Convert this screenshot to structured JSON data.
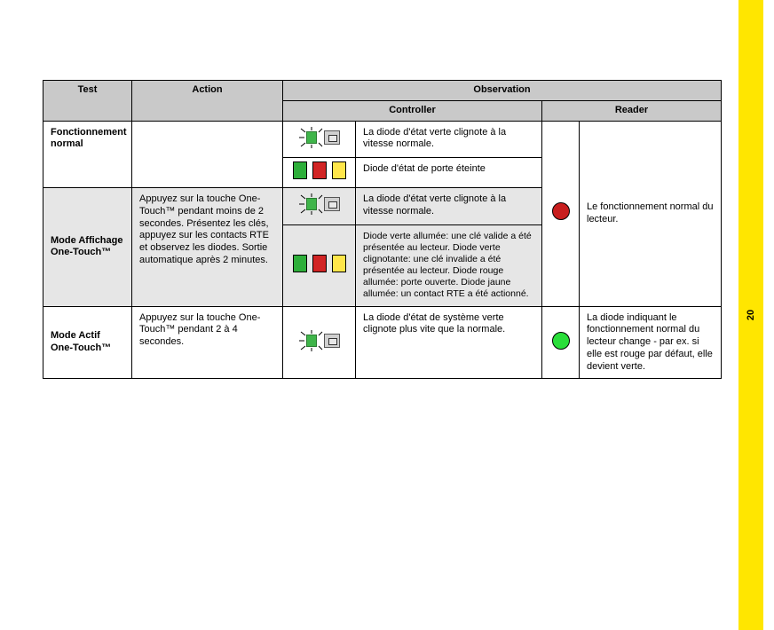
{
  "page_number": "20",
  "headers": {
    "test": "Test",
    "action": "Action",
    "observation": "Observation",
    "controller": "Controller",
    "reader": "Reader"
  },
  "row1": {
    "test": "Fonctionnement normal",
    "ctrl1": "La diode d'état verte clignote à la vitesse normale.",
    "ctrl2": "Diode d'état de porte éteinte"
  },
  "row2": {
    "test": "Mode Affichage One-Touch™",
    "action": "Appuyez sur la touche One-Touch™ pendant moins de 2 secondes. Présentez les clés, appuyez sur les contacts RTE et observez les diodes. Sortie automatique après 2 minutes.",
    "ctrl1": "La diode d'état verte clignote à la vitesse normale.",
    "ctrl2": "Diode verte allumée: une clé valide a été présentée au lecteur. Diode verte clignotante: une clé invalide a été présentée au lecteur. Diode rouge allumée: porte ouverte. Diode jaune allumée: un contact RTE a été actionné."
  },
  "reader12": "Le fonctionnement normal du lecteur.",
  "row3": {
    "test": "Mode Actif One-Touch™",
    "action": "Appuyez sur la touche One-Touch™ pendant 2 à 4 secondes.",
    "ctrl": "La diode d'état de système verte clignote plus vite que la normale.",
    "reader": "La diode indiquant le fonctionnement normal du lecteur change - par ex. si elle est rouge par défaut, elle devient verte."
  }
}
